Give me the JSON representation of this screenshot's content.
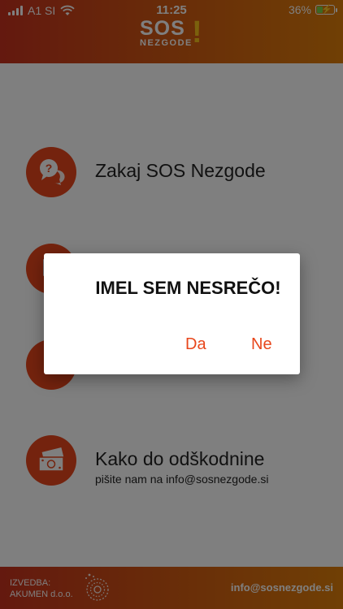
{
  "status_bar": {
    "carrier": "A1 SI",
    "time": "11:25",
    "battery_percent": "36%",
    "battery_level": 0.36
  },
  "header": {
    "logo": {
      "main": "SOS",
      "mark": "!",
      "sub": "NEZGODE"
    }
  },
  "menu": {
    "items": [
      {
        "label": "Zakaj SOS Nezgode",
        "icon": "question-chat-icon"
      },
      {
        "label": "",
        "icon": "documents-icon"
      },
      {
        "label": "",
        "icon": "phone-icon"
      },
      {
        "label": "Kako do odškodnine",
        "sub": "pišite nam na info@sosnezgode.si",
        "icon": "money-icon"
      }
    ]
  },
  "footer": {
    "credit_line1": "IZVEDBA:",
    "credit_line2": "AKUMEN d.o.o.",
    "email": "info@sosnezgode.si"
  },
  "dialog": {
    "title": "IMEL SEM NESREČO!",
    "yes_label": "Da",
    "no_label": "Ne"
  },
  "colors": {
    "accent": "#e8471c",
    "header_start": "#c8321e",
    "header_end": "#e07f0a",
    "logo_mark": "#f6c31a"
  }
}
